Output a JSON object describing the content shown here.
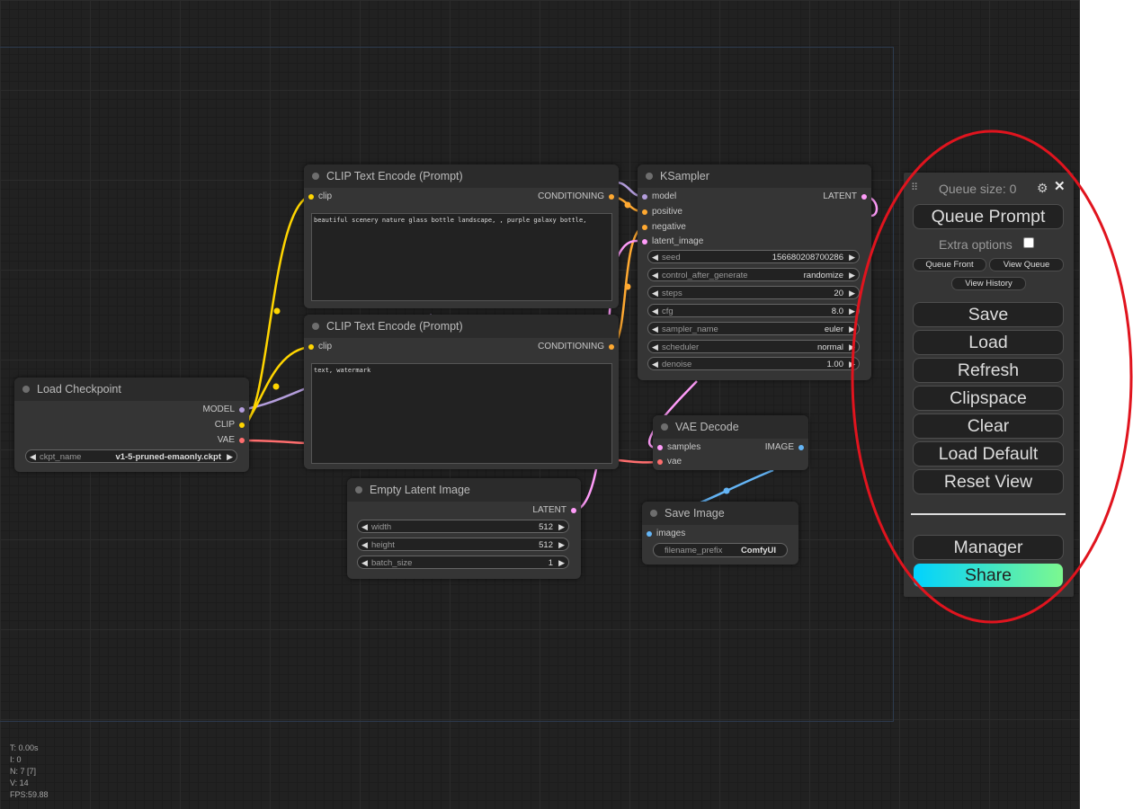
{
  "nodes": {
    "clip_top": {
      "title": "CLIP Text Encode (Prompt)",
      "input": "clip",
      "output": "CONDITIONING",
      "text": "beautiful scenery nature glass bottle landscape, , purple galaxy bottle,"
    },
    "clip_bottom": {
      "title": "CLIP Text Encode (Prompt)",
      "input": "clip",
      "output": "CONDITIONING",
      "text": "text, watermark"
    },
    "ksampler": {
      "title": "KSampler",
      "inputs": [
        "model",
        "positive",
        "negative",
        "latent_image"
      ],
      "output": "LATENT",
      "widgets": [
        {
          "name": "seed",
          "value": "156680208700286"
        },
        {
          "name": "control_after_generate",
          "value": "randomize"
        },
        {
          "name": "steps",
          "value": "20"
        },
        {
          "name": "cfg",
          "value": "8.0"
        },
        {
          "name": "sampler_name",
          "value": "euler"
        },
        {
          "name": "scheduler",
          "value": "normal"
        },
        {
          "name": "denoise",
          "value": "1.00"
        }
      ]
    },
    "load_checkpoint": {
      "title": "Load Checkpoint",
      "outputs": [
        "MODEL",
        "CLIP",
        "VAE"
      ],
      "widget": {
        "name": "ckpt_name",
        "value": "v1-5-pruned-emaonly.ckpt"
      }
    },
    "vae_decode": {
      "title": "VAE Decode",
      "inputs": [
        "samples",
        "vae"
      ],
      "output": "IMAGE"
    },
    "empty_latent": {
      "title": "Empty Latent Image",
      "output": "LATENT",
      "widgets": [
        {
          "name": "width",
          "value": "512"
        },
        {
          "name": "height",
          "value": "512"
        },
        {
          "name": "batch_size",
          "value": "1"
        }
      ]
    },
    "save_image": {
      "title": "Save Image",
      "input": "images",
      "widget": {
        "name": "filename_prefix",
        "value": "ComfyUI"
      }
    }
  },
  "stats": {
    "time": "T: 0.00s",
    "iterations": "I: 0",
    "nodes": "N: 7 [7]",
    "vertices": "V: 14",
    "fps": "FPS:59.88"
  },
  "menu": {
    "drag_handle": "⠿",
    "queue_size": "Queue size: 0",
    "gear_icon": "⚙",
    "close_icon": "✕",
    "queue_prompt": "Queue Prompt",
    "extra_options": "Extra options",
    "queue_front": "Queue Front",
    "view_queue": "View Queue",
    "view_history": "View History",
    "save": "Save",
    "load": "Load",
    "refresh": "Refresh",
    "clipspace": "Clipspace",
    "clear": "Clear",
    "load_default": "Load Default",
    "reset_view": "Reset View",
    "manager": "Manager",
    "share": "Share"
  },
  "arrows": {
    "left": "◀",
    "right": "▶"
  },
  "colors": {
    "clip": "#ffd500",
    "model": "#b39ddb",
    "vae": "#ff6e6e",
    "conditioning": "#ffa931",
    "latent": "#ff9cf9",
    "image": "#64b5f6",
    "annotation": "#e0141e",
    "share_gradient_start": "#00d2ff",
    "share_gradient_end": "#7cf88f"
  }
}
